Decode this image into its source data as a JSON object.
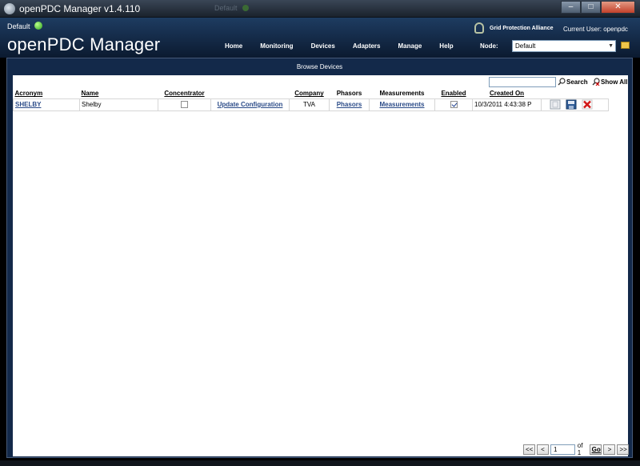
{
  "window": {
    "title": "openPDC Manager v1.4.110",
    "ghost_title": "Default",
    "min_label": "–",
    "max_label": "□",
    "close_label": "✕"
  },
  "header": {
    "instance_label": "Default",
    "app_title": "openPDC Manager",
    "org_label": "Grid Protection Alliance",
    "user_label": "Current User: openpdc",
    "node_label": "Node:",
    "node_value": "Default",
    "nav": [
      "Home",
      "Monitoring",
      "Devices",
      "Adapters",
      "Manage",
      "Help"
    ]
  },
  "panel": {
    "title": "Browse Devices",
    "search_label": "Search",
    "show_all_label": "Show All",
    "search_value": ""
  },
  "grid": {
    "columns": [
      "Acronym",
      "Name",
      "Concentrator",
      "",
      "Company",
      "Phasors",
      "Measurements",
      "Enabled",
      "Created On"
    ],
    "rows": [
      {
        "acronym": "SHELBY",
        "name": "Shelby",
        "concentrator": false,
        "update_config": "Update Configuration",
        "company": "TVA",
        "phasors": "Phasors",
        "measurements": "Measurements",
        "enabled": true,
        "created_on": "10/3/2011 4:43:38 P"
      }
    ]
  },
  "pager": {
    "first": "<<",
    "prev": "<",
    "page": "1",
    "of_label": "of 1",
    "go": "Go",
    "next": ">",
    "last": ">>"
  }
}
